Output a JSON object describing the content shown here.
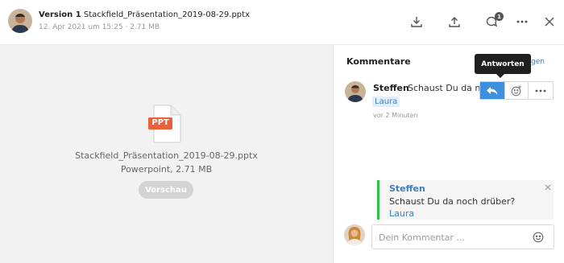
{
  "header": {
    "version_label": "Version 1",
    "file_name": "Stackfield_Präsentation_2019-08-29.pptx",
    "meta": "12. Apr 2021 um 15:25 · 2.71 MB",
    "notification_count": "1",
    "icons": [
      "download-icon",
      "upload-icon",
      "comment-icon",
      "more-icon",
      "close-icon"
    ]
  },
  "preview": {
    "file_badge": "PPT",
    "file_name": "Stackfield_Präsentation_2019-08-29.pptx",
    "file_type": "Powerpoint, 2.71 MB",
    "preview_button": "Vorschau",
    "badge_color": "#e8603c"
  },
  "comments": {
    "title": "Kommentare",
    "show_link": "eigen",
    "items": [
      {
        "author": "Steffen",
        "text": "Schaust Du da noch drüber?",
        "mention": "Laura",
        "time": "vor 2 Minuten"
      }
    ],
    "tooltip": "Antworten",
    "reply_context": {
      "author": "Steffen",
      "text": "Schaust Du da noch drüber?",
      "mention": "Laura"
    },
    "input_placeholder": "Dein Kommentar ...",
    "accent": "#3d8fe0",
    "reply_bar_color": "#2fbf4a"
  }
}
